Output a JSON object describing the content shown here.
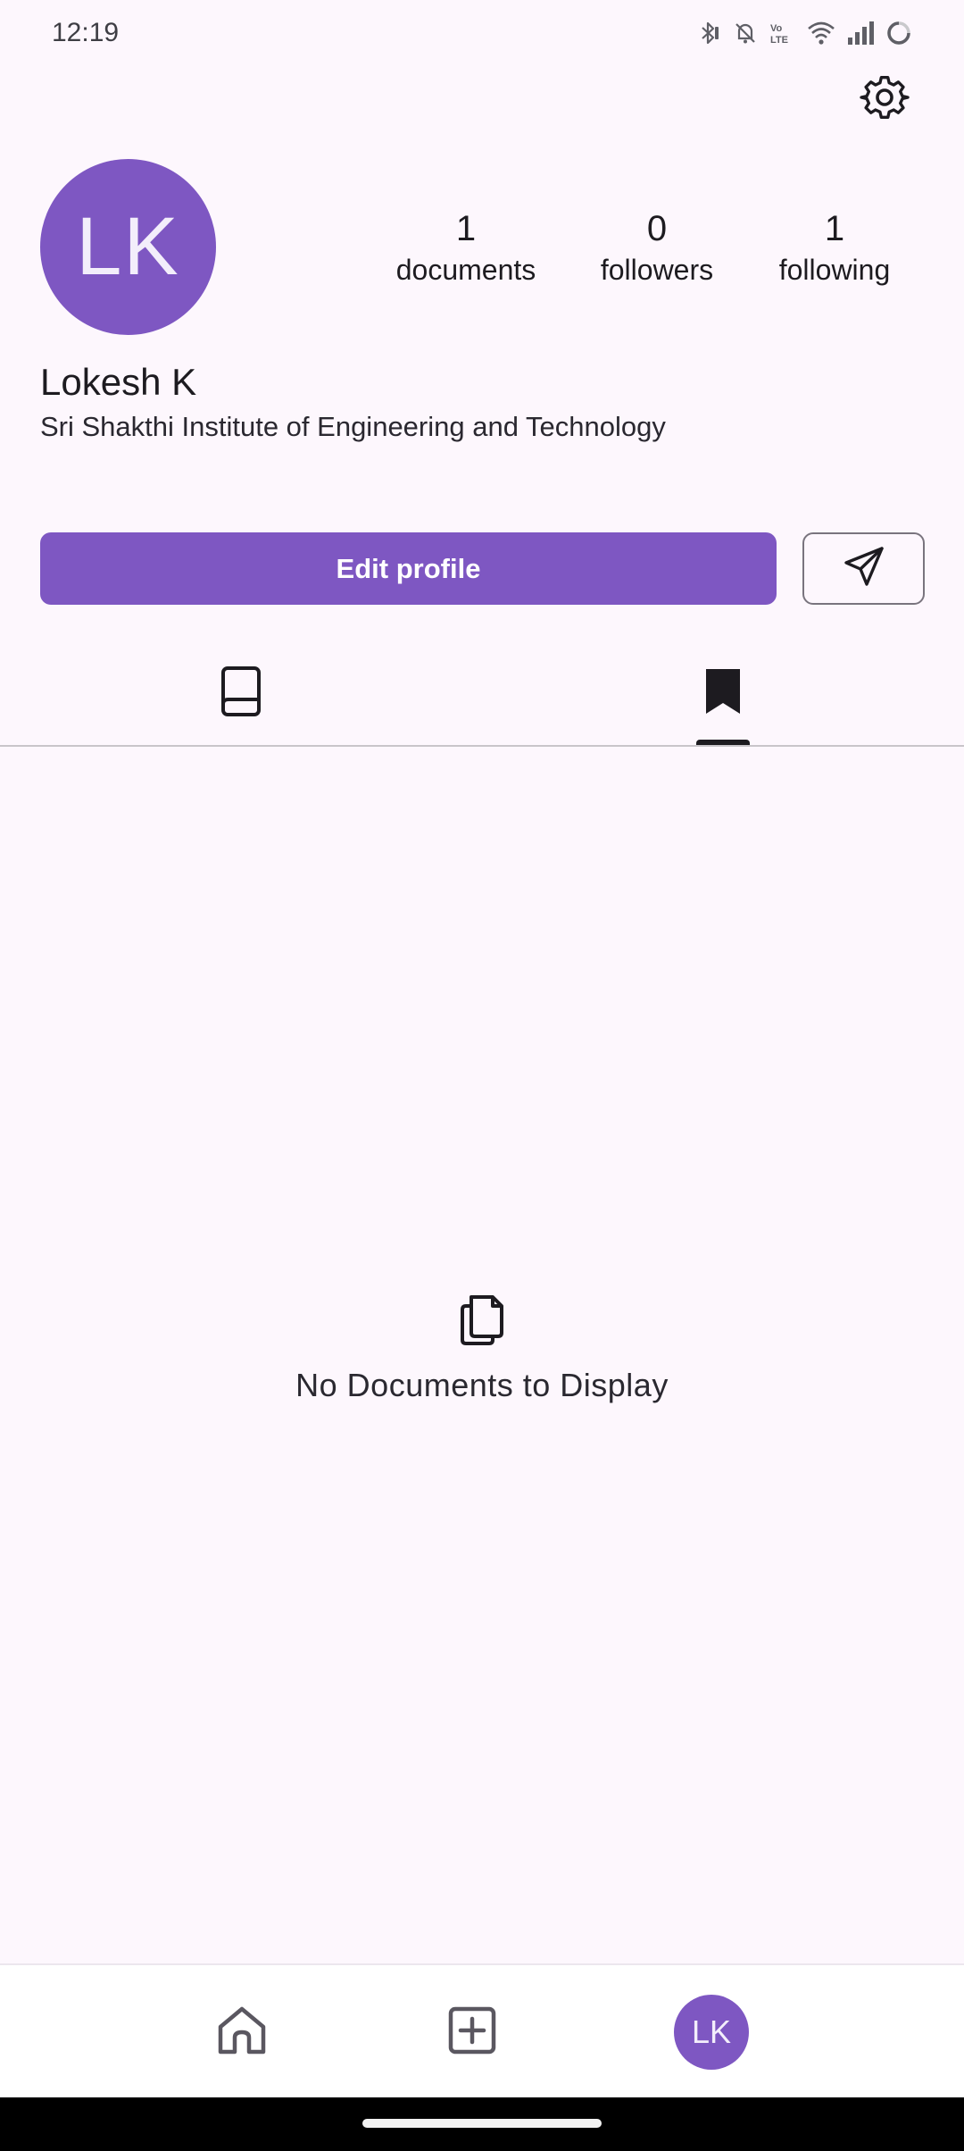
{
  "status_bar": {
    "time": "12:19",
    "icons": [
      "bluetooth-icon",
      "mute-icon",
      "volte-icon",
      "wifi-icon",
      "signal-icon",
      "battery-icon"
    ]
  },
  "header": {
    "settings_icon": "gear-icon"
  },
  "profile": {
    "avatar_initials": "LK",
    "name": "Lokesh K",
    "organization": "Sri Shakthi Institute of Engineering and Technology",
    "avatar_color": "#7e57c2"
  },
  "stats": [
    {
      "count": "1",
      "label": "documents"
    },
    {
      "count": "0",
      "label": "followers"
    },
    {
      "count": "1",
      "label": "following"
    }
  ],
  "actions": {
    "edit_label": "Edit profile",
    "share_icon": "send-icon"
  },
  "tabs": [
    {
      "icon": "book-icon",
      "selected": false
    },
    {
      "icon": "bookmark-icon",
      "selected": true
    }
  ],
  "empty_state": {
    "icon": "documents-icon",
    "text": "No Documents to Display"
  },
  "bottom_nav": {
    "items": [
      "home-icon",
      "add-icon",
      "profile-avatar"
    ],
    "avatar_initials": "LK"
  },
  "colors": {
    "accent": "#7e57c2",
    "background": "#fdf7fd"
  }
}
